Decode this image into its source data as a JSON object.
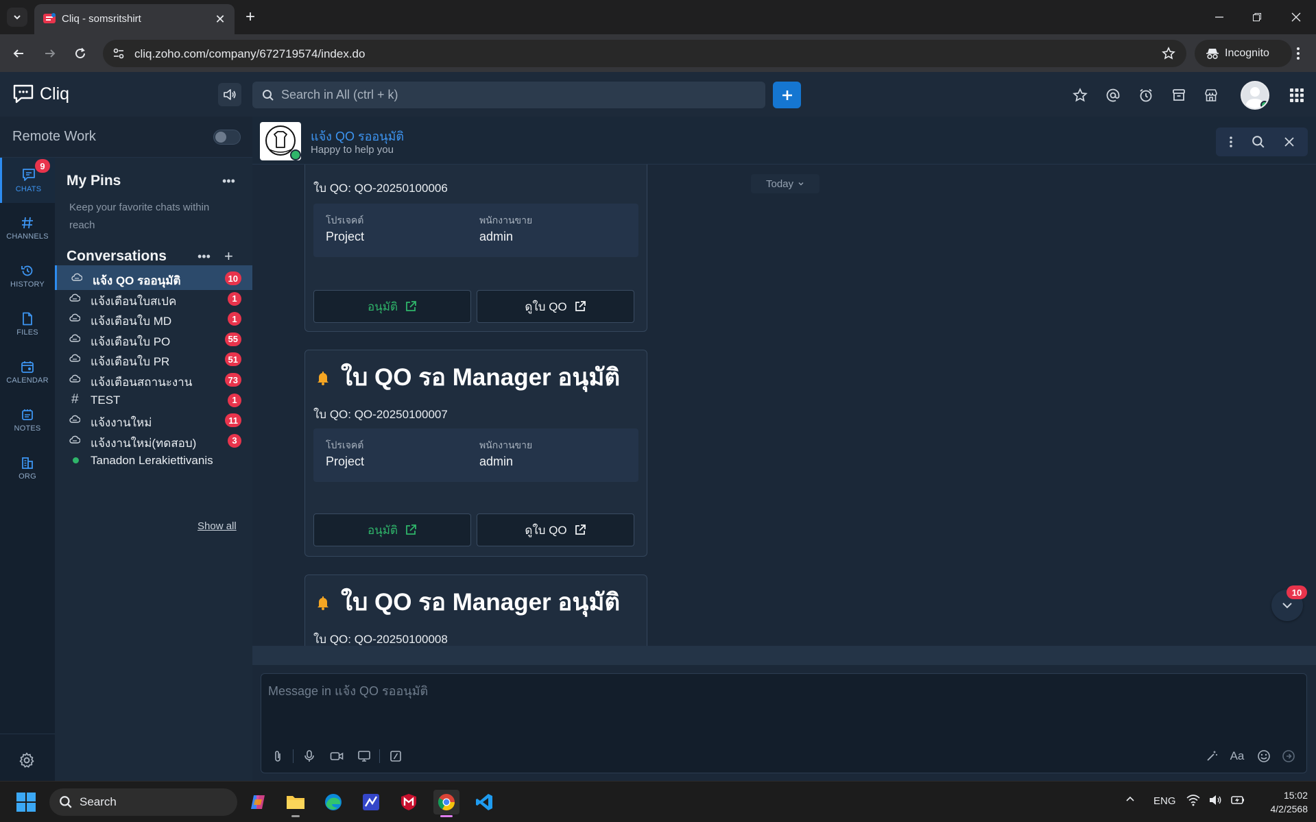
{
  "browser": {
    "tab_title": "Cliq - somsritshirt",
    "url": "cliq.zoho.com/company/672719574/index.do",
    "incognito_label": "Incognito"
  },
  "app": {
    "name": "Cliq",
    "search_placeholder": "Search in All (ctrl + k)",
    "accent_color": "#1576d1",
    "badge_color": "#e8344c"
  },
  "remote_work": {
    "label": "Remote Work",
    "enabled": false
  },
  "rail": {
    "items": [
      {
        "label": "CHATS",
        "icon": "chat-icon",
        "badge": "9",
        "active": true
      },
      {
        "label": "CHANNELS",
        "icon": "hash-icon"
      },
      {
        "label": "HISTORY",
        "icon": "history-icon"
      },
      {
        "label": "FILES",
        "icon": "file-icon"
      },
      {
        "label": "CALENDAR",
        "icon": "calendar-icon"
      },
      {
        "label": "NOTES",
        "icon": "notes-icon"
      },
      {
        "label": "ORG",
        "icon": "org-icon"
      }
    ]
  },
  "pins": {
    "title": "My Pins",
    "hint": "Keep your favorite chats within reach"
  },
  "conversations": {
    "title": "Conversations",
    "show_all": "Show all",
    "items": [
      {
        "name": "แจ้ง QO รออนุมัติ",
        "badge": "10",
        "kind": "bot",
        "active": true
      },
      {
        "name": "แจ้งเตือนใบสเปค",
        "badge": "1",
        "kind": "bot"
      },
      {
        "name": "แจ้งเตือนใบ MD",
        "badge": "1",
        "kind": "bot"
      },
      {
        "name": "แจ้งเตือนใบ PO",
        "badge": "55",
        "kind": "bot"
      },
      {
        "name": "แจ้งเตือนใบ PR",
        "badge": "51",
        "kind": "bot"
      },
      {
        "name": "แจ้งเตือนสถานะงาน",
        "badge": "73",
        "kind": "bot"
      },
      {
        "name": "TEST",
        "badge": "1",
        "kind": "channel"
      },
      {
        "name": "แจ้งงานใหม่",
        "badge": "11",
        "kind": "bot"
      },
      {
        "name": "แจ้งงานใหม่(ทดสอบ)",
        "badge": "3",
        "kind": "bot"
      },
      {
        "name": "Tanadon Lerakiettivanis",
        "badge": "",
        "kind": "user"
      }
    ]
  },
  "chat": {
    "name": "แจ้ง QO รออนุมัติ",
    "status": "Happy to help you",
    "date_divider": "Today",
    "composer_placeholder": "Message in แจ้ง QO รออนุมัติ",
    "unread_badge": "10",
    "cards": [
      {
        "title": "",
        "qo": "ใบ QO: QO-20250100006",
        "fields": [
          {
            "key": "โปรเจคต์",
            "value": "Project"
          },
          {
            "key": "พนักงานขาย",
            "value": "admin"
          }
        ],
        "approve_label": "อนุมัติ",
        "view_label": "ดูใบ QO"
      },
      {
        "title": "ใบ QO รอ Manager อนุมัติ",
        "qo": "ใบ QO: QO-20250100007",
        "fields": [
          {
            "key": "โปรเจคต์",
            "value": "Project"
          },
          {
            "key": "พนักงานขาย",
            "value": "admin"
          }
        ],
        "approve_label": "อนุมัติ",
        "view_label": "ดูใบ QO"
      },
      {
        "title": "ใบ QO รอ Manager อนุมัติ",
        "qo": "ใบ QO: QO-20250100008"
      }
    ]
  },
  "taskbar": {
    "search_label": "Search",
    "language": "ENG",
    "time": "15:02",
    "date": "4/2/2568"
  }
}
